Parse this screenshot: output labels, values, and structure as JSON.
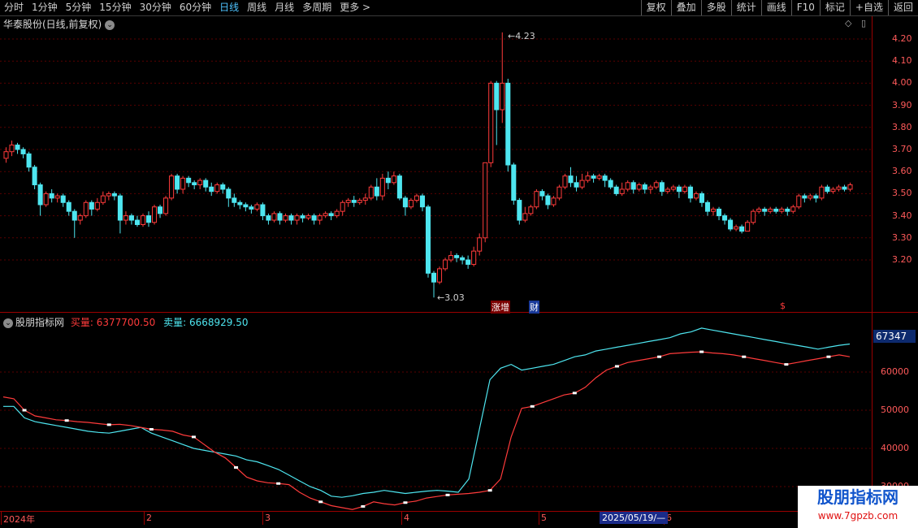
{
  "toolbar": {
    "periods": [
      "分时",
      "1分钟",
      "5分钟",
      "15分钟",
      "30分钟",
      "60分钟",
      "日线",
      "周线",
      "月线",
      "多周期",
      "更多 >"
    ],
    "active_period": "日线",
    "buttons": [
      "复权",
      "叠加",
      "多股",
      "统计",
      "画线",
      "F10",
      "标记",
      "+自选",
      "返回"
    ]
  },
  "price_panel": {
    "title": "华泰股份(日线,前复权)",
    "high_label": "4.23",
    "low_label": "3.03",
    "event_markers": [
      "涨增",
      "财",
      "$"
    ]
  },
  "indicator_panel": {
    "name": "股朋指标网",
    "buy_label": "买量:",
    "buy_value": "6377700.50",
    "sell_label": "卖量:",
    "sell_value": "6668929.50",
    "current_value": "67347"
  },
  "date_axis": {
    "labels": [
      "2024年",
      "2",
      "3",
      "4",
      "5",
      "6"
    ],
    "highlight": "2025/05/19/—"
  },
  "watermark": {
    "title": "股朋指标网",
    "url": "www.7gpzb.com"
  },
  "colors": {
    "up": "#ff3b3b",
    "down": "#4ee6f0",
    "axis": "#9a0000",
    "bg": "#000000"
  },
  "chart_data": [
    {
      "type": "candlestick",
      "title": "华泰股份(日线,前复权)",
      "y_ticks": [
        "4.20",
        "4.10",
        "4.00",
        "3.90",
        "3.80",
        "3.70",
        "3.60",
        "3.50",
        "3.40",
        "3.30",
        "3.20"
      ],
      "ylim": [
        3.03,
        4.23
      ],
      "candles": [
        [
          3.66,
          3.69,
          3.64,
          3.71
        ],
        [
          3.69,
          3.72,
          3.67,
          3.74
        ],
        [
          3.72,
          3.7,
          3.68,
          3.73
        ],
        [
          3.7,
          3.68,
          3.66,
          3.71
        ],
        [
          3.68,
          3.62,
          3.6,
          3.69
        ],
        [
          3.62,
          3.54,
          3.52,
          3.63
        ],
        [
          3.54,
          3.45,
          3.4,
          3.55
        ],
        [
          3.45,
          3.5,
          3.44,
          3.51
        ],
        [
          3.5,
          3.48,
          3.46,
          3.52
        ],
        [
          3.48,
          3.49,
          3.46,
          3.5
        ],
        [
          3.49,
          3.46,
          3.44,
          3.5
        ],
        [
          3.46,
          3.42,
          3.4,
          3.47
        ],
        [
          3.42,
          3.38,
          3.3,
          3.43
        ],
        [
          3.38,
          3.4,
          3.36,
          3.41
        ],
        [
          3.4,
          3.46,
          3.39,
          3.47
        ],
        [
          3.46,
          3.43,
          3.4,
          3.47
        ],
        [
          3.43,
          3.46,
          3.42,
          3.48
        ],
        [
          3.46,
          3.49,
          3.45,
          3.51
        ],
        [
          3.49,
          3.5,
          3.47,
          3.51
        ],
        [
          3.5,
          3.49,
          3.47,
          3.51
        ],
        [
          3.49,
          3.38,
          3.32,
          3.5
        ],
        [
          3.38,
          3.4,
          3.36,
          3.42
        ],
        [
          3.4,
          3.38,
          3.36,
          3.41
        ],
        [
          3.38,
          3.36,
          3.35,
          3.4
        ],
        [
          3.36,
          3.4,
          3.35,
          3.41
        ],
        [
          3.4,
          3.37,
          3.35,
          3.42
        ],
        [
          3.37,
          3.44,
          3.36,
          3.45
        ],
        [
          3.44,
          3.41,
          3.39,
          3.45
        ],
        [
          3.41,
          3.48,
          3.4,
          3.49
        ],
        [
          3.48,
          3.58,
          3.47,
          3.59
        ],
        [
          3.58,
          3.52,
          3.5,
          3.59
        ],
        [
          3.52,
          3.57,
          3.5,
          3.58
        ],
        [
          3.57,
          3.55,
          3.53,
          3.58
        ],
        [
          3.55,
          3.54,
          3.52,
          3.56
        ],
        [
          3.54,
          3.56,
          3.52,
          3.57
        ],
        [
          3.56,
          3.53,
          3.51,
          3.57
        ],
        [
          3.53,
          3.51,
          3.49,
          3.55
        ],
        [
          3.51,
          3.54,
          3.5,
          3.55
        ],
        [
          3.54,
          3.52,
          3.5,
          3.55
        ],
        [
          3.52,
          3.48,
          3.44,
          3.53
        ],
        [
          3.48,
          3.46,
          3.44,
          3.5
        ],
        [
          3.46,
          3.45,
          3.43,
          3.47
        ],
        [
          3.45,
          3.44,
          3.42,
          3.46
        ],
        [
          3.44,
          3.43,
          3.41,
          3.45
        ],
        [
          3.43,
          3.45,
          3.42,
          3.46
        ],
        [
          3.45,
          3.4,
          3.38,
          3.46
        ],
        [
          3.4,
          3.38,
          3.36,
          3.41
        ],
        [
          3.38,
          3.41,
          3.37,
          3.42
        ],
        [
          3.41,
          3.38,
          3.36,
          3.42
        ],
        [
          3.38,
          3.4,
          3.37,
          3.41
        ],
        [
          3.4,
          3.38,
          3.36,
          3.41
        ],
        [
          3.38,
          3.4,
          3.36,
          3.41
        ],
        [
          3.4,
          3.39,
          3.37,
          3.41
        ],
        [
          3.39,
          3.4,
          3.38,
          3.41
        ],
        [
          3.4,
          3.38,
          3.36,
          3.41
        ],
        [
          3.38,
          3.4,
          3.36,
          3.41
        ],
        [
          3.4,
          3.41,
          3.39,
          3.42
        ],
        [
          3.41,
          3.4,
          3.38,
          3.42
        ],
        [
          3.4,
          3.42,
          3.39,
          3.43
        ],
        [
          3.42,
          3.46,
          3.4,
          3.47
        ],
        [
          3.46,
          3.47,
          3.44,
          3.48
        ],
        [
          3.47,
          3.46,
          3.44,
          3.49
        ],
        [
          3.46,
          3.47,
          3.45,
          3.48
        ],
        [
          3.47,
          3.48,
          3.45,
          3.5
        ],
        [
          3.48,
          3.53,
          3.47,
          3.54
        ],
        [
          3.53,
          3.49,
          3.47,
          3.57
        ],
        [
          3.49,
          3.57,
          3.47,
          3.59
        ],
        [
          3.57,
          3.55,
          3.52,
          3.6
        ],
        [
          3.55,
          3.58,
          3.54,
          3.6
        ],
        [
          3.58,
          3.48,
          3.47,
          3.59
        ],
        [
          3.48,
          3.44,
          3.4,
          3.49
        ],
        [
          3.44,
          3.47,
          3.43,
          3.48
        ],
        [
          3.47,
          3.49,
          3.46,
          3.5
        ],
        [
          3.49,
          3.44,
          3.42,
          3.5
        ],
        [
          3.44,
          3.14,
          3.12,
          3.45
        ],
        [
          3.14,
          3.1,
          3.03,
          3.15
        ],
        [
          3.1,
          3.16,
          3.09,
          3.17
        ],
        [
          3.16,
          3.2,
          3.15,
          3.21
        ],
        [
          3.2,
          3.22,
          3.19,
          3.24
        ],
        [
          3.22,
          3.21,
          3.19,
          3.23
        ],
        [
          3.21,
          3.2,
          3.18,
          3.22
        ],
        [
          3.2,
          3.18,
          3.16,
          3.22
        ],
        [
          3.18,
          3.24,
          3.17,
          3.26
        ],
        [
          3.24,
          3.3,
          3.22,
          3.32
        ],
        [
          3.3,
          3.64,
          3.28,
          3.64
        ],
        [
          3.64,
          4.0,
          3.62,
          4.01
        ],
        [
          4.0,
          3.88,
          3.72,
          4.01
        ],
        [
          3.88,
          4.0,
          3.82,
          4.23
        ],
        [
          4.0,
          3.63,
          3.6,
          4.02
        ],
        [
          3.63,
          3.47,
          3.45,
          3.64
        ],
        [
          3.47,
          3.38,
          3.36,
          3.48
        ],
        [
          3.38,
          3.41,
          3.37,
          3.44
        ],
        [
          3.41,
          3.44,
          3.4,
          3.45
        ],
        [
          3.44,
          3.51,
          3.43,
          3.52
        ],
        [
          3.51,
          3.49,
          3.47,
          3.52
        ],
        [
          3.49,
          3.45,
          3.43,
          3.5
        ],
        [
          3.45,
          3.48,
          3.44,
          3.49
        ],
        [
          3.48,
          3.53,
          3.47,
          3.54
        ],
        [
          3.53,
          3.58,
          3.52,
          3.59
        ],
        [
          3.58,
          3.55,
          3.53,
          3.62
        ],
        [
          3.55,
          3.53,
          3.51,
          3.58
        ],
        [
          3.53,
          3.56,
          3.52,
          3.59
        ],
        [
          3.56,
          3.58,
          3.55,
          3.6
        ],
        [
          3.58,
          3.57,
          3.55,
          3.59
        ],
        [
          3.57,
          3.58,
          3.56,
          3.59
        ],
        [
          3.58,
          3.56,
          3.53,
          3.59
        ],
        [
          3.56,
          3.53,
          3.52,
          3.57
        ],
        [
          3.53,
          3.5,
          3.49,
          3.54
        ],
        [
          3.5,
          3.52,
          3.49,
          3.55
        ],
        [
          3.52,
          3.55,
          3.51,
          3.56
        ],
        [
          3.55,
          3.52,
          3.5,
          3.56
        ],
        [
          3.52,
          3.54,
          3.51,
          3.55
        ],
        [
          3.54,
          3.52,
          3.5,
          3.55
        ],
        [
          3.52,
          3.53,
          3.5,
          3.54
        ],
        [
          3.53,
          3.55,
          3.52,
          3.56
        ],
        [
          3.55,
          3.51,
          3.49,
          3.56
        ],
        [
          3.51,
          3.52,
          3.5,
          3.53
        ],
        [
          3.52,
          3.53,
          3.51,
          3.54
        ],
        [
          3.53,
          3.51,
          3.48,
          3.54
        ],
        [
          3.51,
          3.53,
          3.5,
          3.54
        ],
        [
          3.53,
          3.48,
          3.46,
          3.54
        ],
        [
          3.48,
          3.5,
          3.47,
          3.51
        ],
        [
          3.5,
          3.46,
          3.44,
          3.51
        ],
        [
          3.46,
          3.42,
          3.4,
          3.47
        ],
        [
          3.42,
          3.43,
          3.4,
          3.44
        ],
        [
          3.43,
          3.4,
          3.38,
          3.44
        ],
        [
          3.4,
          3.38,
          3.36,
          3.41
        ],
        [
          3.38,
          3.34,
          3.33,
          3.39
        ],
        [
          3.34,
          3.35,
          3.33,
          3.36
        ],
        [
          3.35,
          3.33,
          3.32,
          3.36
        ],
        [
          3.33,
          3.37,
          3.33,
          3.38
        ],
        [
          3.37,
          3.42,
          3.36,
          3.43
        ],
        [
          3.42,
          3.43,
          3.41,
          3.44
        ],
        [
          3.43,
          3.42,
          3.4,
          3.44
        ],
        [
          3.42,
          3.43,
          3.41,
          3.44
        ],
        [
          3.43,
          3.42,
          3.41,
          3.44
        ],
        [
          3.42,
          3.43,
          3.41,
          3.44
        ],
        [
          3.43,
          3.42,
          3.4,
          3.44
        ],
        [
          3.42,
          3.44,
          3.41,
          3.45
        ],
        [
          3.44,
          3.49,
          3.43,
          3.5
        ],
        [
          3.49,
          3.48,
          3.46,
          3.5
        ],
        [
          3.48,
          3.49,
          3.47,
          3.5
        ],
        [
          3.49,
          3.48,
          3.46,
          3.5
        ],
        [
          3.48,
          3.53,
          3.47,
          3.54
        ],
        [
          3.53,
          3.51,
          3.5,
          3.54
        ],
        [
          3.51,
          3.52,
          3.5,
          3.53
        ],
        [
          3.52,
          3.53,
          3.51,
          3.54
        ],
        [
          3.53,
          3.52,
          3.51,
          3.54
        ],
        [
          3.52,
          3.54,
          3.51,
          3.55
        ]
      ]
    },
    {
      "type": "line",
      "title": "股朋指标网",
      "y_ticks": [
        "60000",
        "50000",
        "40000",
        "30000"
      ],
      "ylim": [
        23000,
        72000
      ],
      "series": [
        {
          "name": "买量",
          "color": "#ff3b3b",
          "values": [
            53500,
            53000,
            50000,
            48500,
            48000,
            47500,
            47300,
            47000,
            46800,
            46500,
            46200,
            46300,
            46000,
            45500,
            45000,
            44800,
            44500,
            43500,
            43000,
            41000,
            39000,
            37500,
            35000,
            32500,
            31500,
            31000,
            30800,
            30500,
            28500,
            27000,
            26000,
            25000,
            24500,
            24000,
            24800,
            26000,
            25500,
            25200,
            25800,
            26200,
            27000,
            27400,
            27800,
            28000,
            28200,
            28500,
            29000,
            32000,
            43000,
            50500,
            51000,
            52000,
            53000,
            54000,
            54500,
            56000,
            58500,
            60500,
            61500,
            62500,
            63000,
            63500,
            64000,
            64800,
            65000,
            65200,
            65300,
            65000,
            64800,
            64500,
            64000,
            63500,
            63000,
            62500,
            62000,
            62500,
            63000,
            63500,
            64000,
            64500,
            64000
          ]
        },
        {
          "name": "卖量",
          "color": "#4ee6f0",
          "values": [
            51000,
            51000,
            48000,
            47000,
            46500,
            46000,
            45500,
            45000,
            44500,
            44200,
            44000,
            44500,
            45000,
            45500,
            44000,
            43000,
            42000,
            41000,
            40000,
            39500,
            39000,
            38500,
            38000,
            37000,
            36500,
            35500,
            34500,
            33000,
            31500,
            30000,
            29000,
            27500,
            27200,
            27600,
            28200,
            28500,
            29000,
            28600,
            28200,
            28500,
            28800,
            29000,
            28800,
            28500,
            32000,
            45000,
            58000,
            61000,
            62000,
            60500,
            61000,
            61500,
            62000,
            63000,
            64000,
            64500,
            65500,
            66000,
            66500,
            67000,
            67500,
            68000,
            68500,
            69000,
            70000,
            70500,
            71500,
            71000,
            70500,
            70000,
            69500,
            69000,
            68500,
            68000,
            67500,
            67000,
            66500,
            66000,
            66500,
            67000,
            67347
          ]
        }
      ]
    }
  ]
}
